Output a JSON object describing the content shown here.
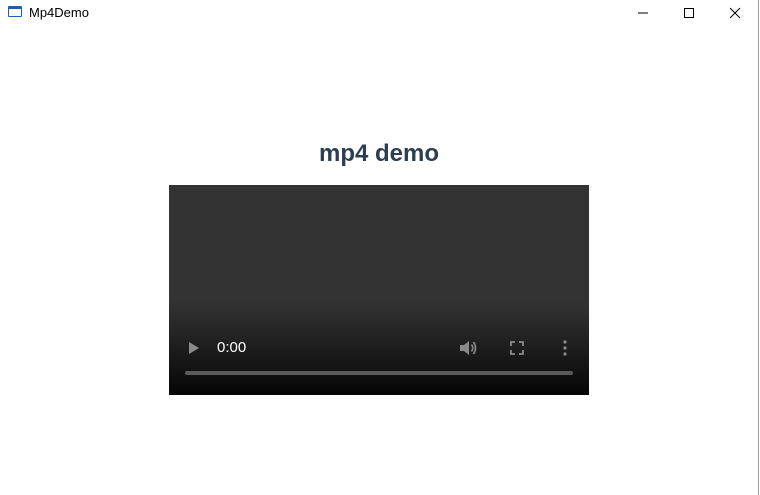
{
  "window": {
    "title": "Mp4Demo",
    "controls": {
      "minimize_icon": "minimize-icon",
      "maximize_icon": "maximize-icon",
      "close_icon": "close-icon"
    }
  },
  "page": {
    "heading": "mp4 demo"
  },
  "video": {
    "current_time": "0:00",
    "progress": 0,
    "controls": {
      "play_icon": "play-icon",
      "volume_icon": "volume-icon",
      "fullscreen_icon": "fullscreen-icon",
      "more_icon": "more-vertical-icon"
    }
  },
  "colors": {
    "heading": "#2c3e50",
    "video_background": "#333333",
    "app_icon": "#1a5fb4"
  }
}
